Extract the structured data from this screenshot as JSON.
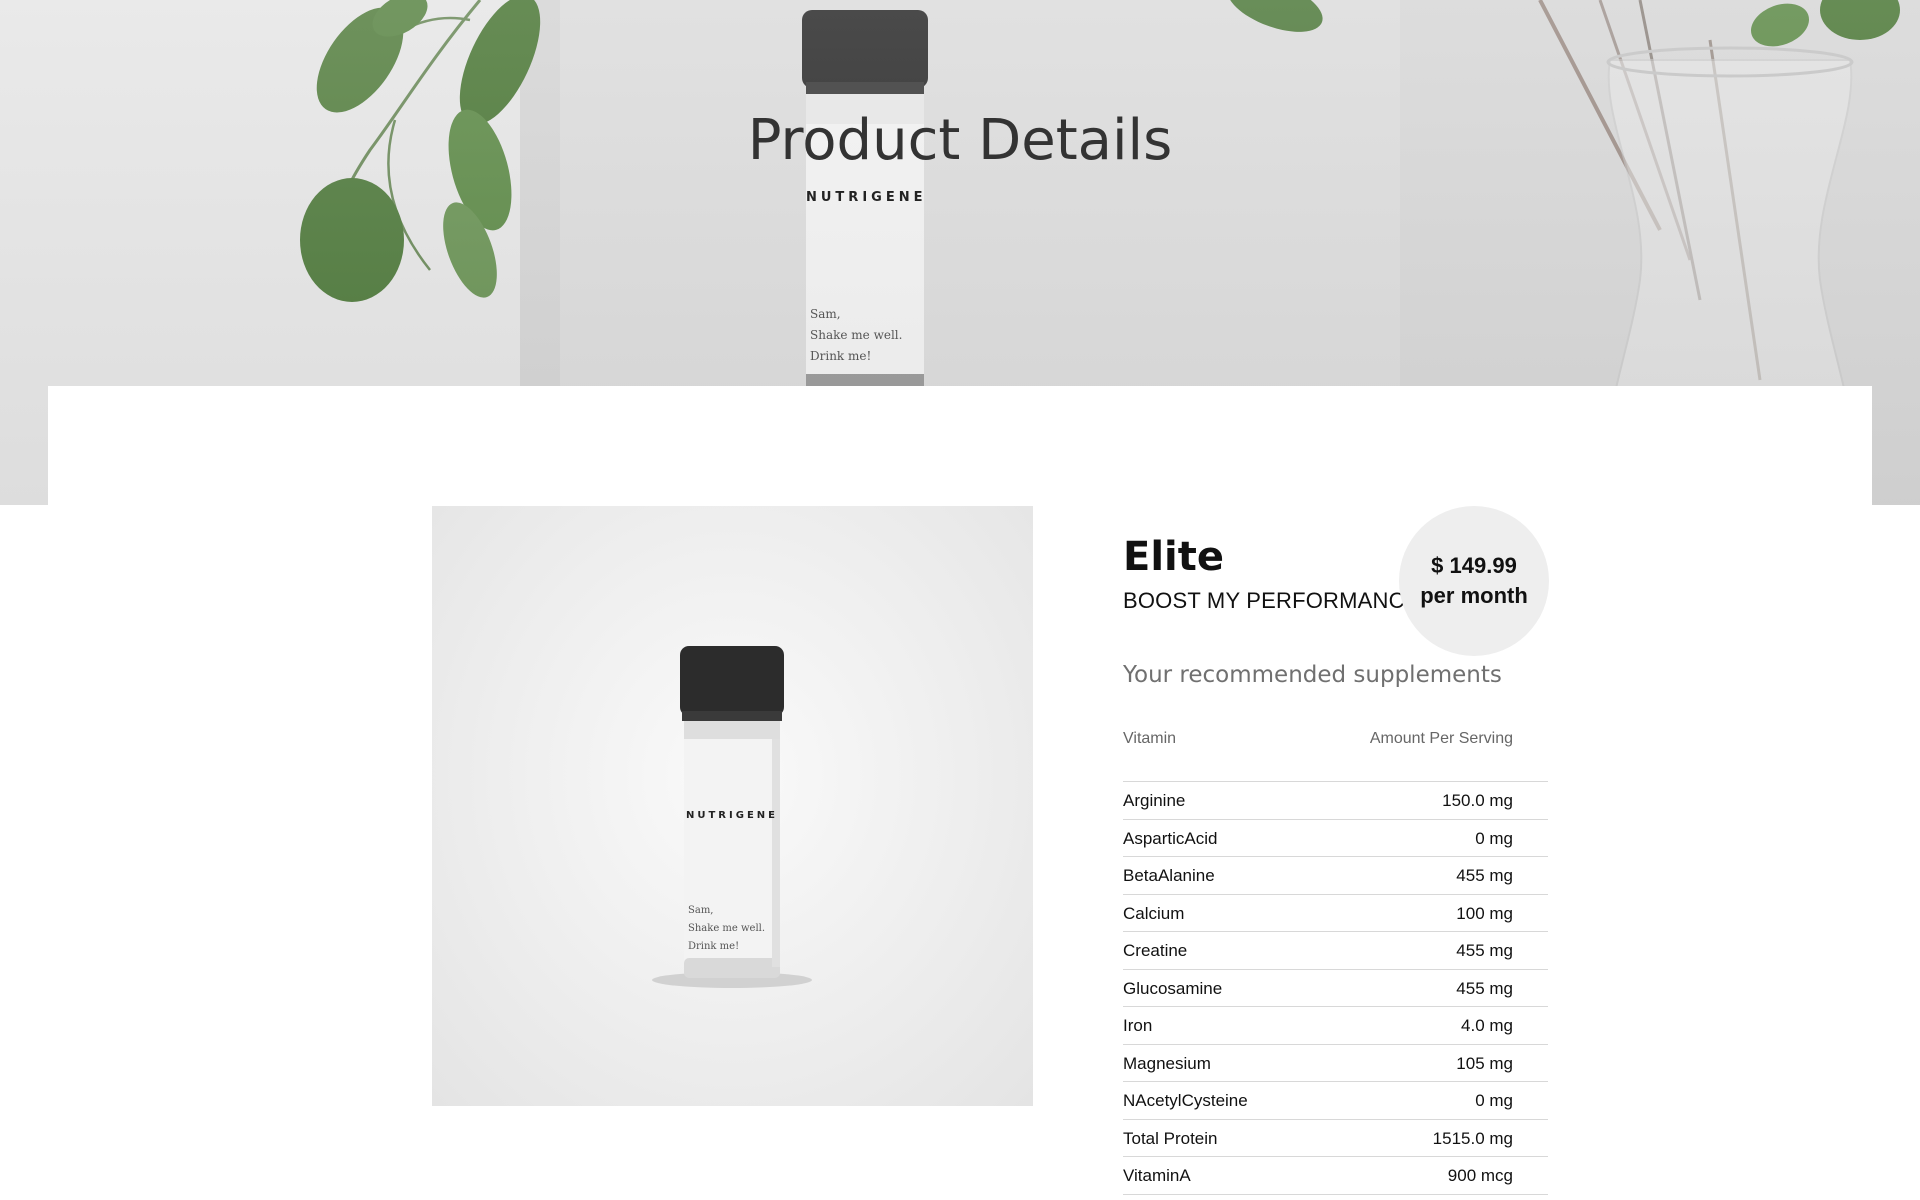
{
  "hero": {
    "title": "Product Details",
    "bottle_brand": "NUTRIGENE",
    "bottle_note": [
      "Sam,",
      "Shake me well.",
      "Drink me!"
    ]
  },
  "product": {
    "image_brand": "NUTRIGENE",
    "image_note": [
      "Sam,",
      "Shake me well.",
      "Drink me!"
    ],
    "name": "Elite",
    "tagline": "BOOST MY PERFORMANCE",
    "price": "$ 149.99",
    "price_period": "per month"
  },
  "supplements": {
    "heading": "Your recommended supplements",
    "columns": [
      "Vitamin",
      "Amount Per Serving"
    ],
    "rows": [
      {
        "name": "Arginine",
        "amount": "150.0 mg"
      },
      {
        "name": "AsparticAcid",
        "amount": "0 mg"
      },
      {
        "name": "BetaAlanine",
        "amount": "455 mg"
      },
      {
        "name": "Calcium",
        "amount": "100 mg"
      },
      {
        "name": "Creatine",
        "amount": "455 mg"
      },
      {
        "name": "Glucosamine",
        "amount": "455 mg"
      },
      {
        "name": "Iron",
        "amount": "4.0 mg"
      },
      {
        "name": "Magnesium",
        "amount": "105 mg"
      },
      {
        "name": "NAcetylCysteine",
        "amount": "0 mg"
      },
      {
        "name": "Total Protein",
        "amount": "1515.0 mg"
      },
      {
        "name": "VitaminA",
        "amount": "900 mcg"
      }
    ]
  },
  "colors": {
    "hero_background": "#d8d8d8",
    "leaf_green": "#4f7a3c",
    "cap_black": "#2a2a2a",
    "price_badge": "#eeeeee",
    "heading_gray": "#707070"
  }
}
